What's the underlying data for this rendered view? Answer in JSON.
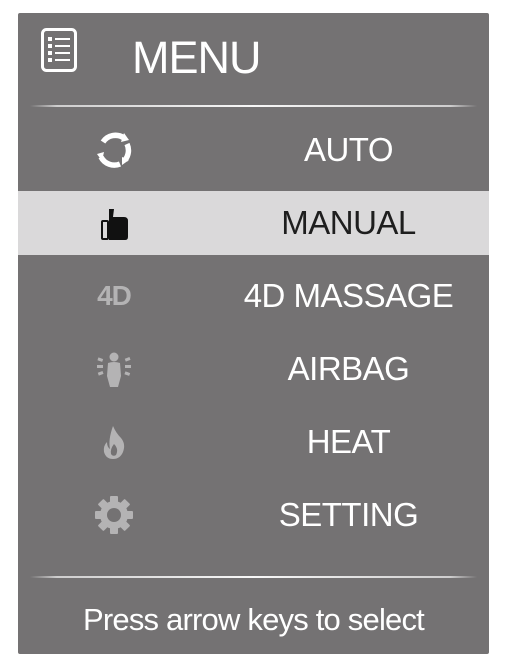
{
  "header": {
    "title": "MENU",
    "icon": "list-menu-icon"
  },
  "menu": {
    "items": [
      {
        "label": "AUTO",
        "icon": "cycle-arrows-icon",
        "selected": false
      },
      {
        "label": "MANUAL",
        "icon": "thumbs-up-icon",
        "selected": true
      },
      {
        "label": "4D MASSAGE",
        "icon": "4d-icon",
        "icon_text": "4D",
        "selected": false
      },
      {
        "label": "AIRBAG",
        "icon": "airbag-body-icon",
        "selected": false
      },
      {
        "label": "HEAT",
        "icon": "flame-icon",
        "selected": false
      },
      {
        "label": "SETTING",
        "icon": "gear-icon",
        "selected": false
      }
    ]
  },
  "footer": {
    "hint": "Press arrow keys to select"
  },
  "colors": {
    "panel_bg": "#747273",
    "selected_bg": "#dad9da",
    "text": "#ffffff",
    "selected_text": "#1e1e1e",
    "dim_icon": "#b4b3b4"
  }
}
